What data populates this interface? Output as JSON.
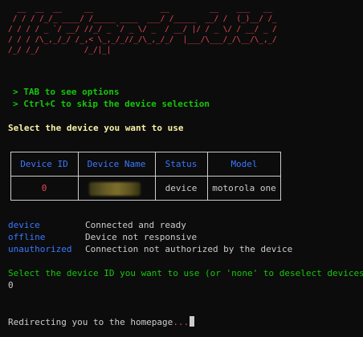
{
  "banner": {
    "ascii_art": "  __  __  __     __               __         __    ___   __ \n / / / /_/_ ____/ /_____ ____  ___/ /_____  __/ /  (_)__/ /_\n/ / / / _ `/ __/ //_/ _ `/ _ \\/ _  / __/ |/ / _ \\/ / __/ _ /\n/ / / /\\_,_/_/ /_,< \\_,_/_//_/\\_,_/_/  |___/\\___/_/\\__/\\_,_/ \n/_/ /_/          /_/|_|                                      ",
    "color": "#e74856"
  },
  "hints": [
    "> TAB to see options",
    "> Ctrl+C to skip the device selection"
  ],
  "select_prompt": "Select the device you want to use",
  "table": {
    "headers": [
      "Device ID",
      "Device Name",
      "Status",
      "Model"
    ],
    "rows": [
      {
        "id": "0",
        "name": "",
        "status": "device",
        "model": "motorola one"
      }
    ]
  },
  "legend": [
    {
      "key": "device",
      "desc": "Connected and ready"
    },
    {
      "key": "offline",
      "desc": "Device not responsive"
    },
    {
      "key": "unauthorized",
      "desc": "Connection not authorized by the device"
    }
  ],
  "ask_prompt": "Select the device ID you want to use (or 'none' to deselect devices):",
  "answer": "0",
  "redirect": {
    "message": "Redirecting you to the homepage",
    "dots": "..."
  },
  "colors": {
    "background": "#0c0c0c",
    "text": "#cccccc",
    "green": "#16c60c",
    "yellow": "#f9f1a5",
    "blue": "#3b78ff",
    "red": "#e74856"
  }
}
